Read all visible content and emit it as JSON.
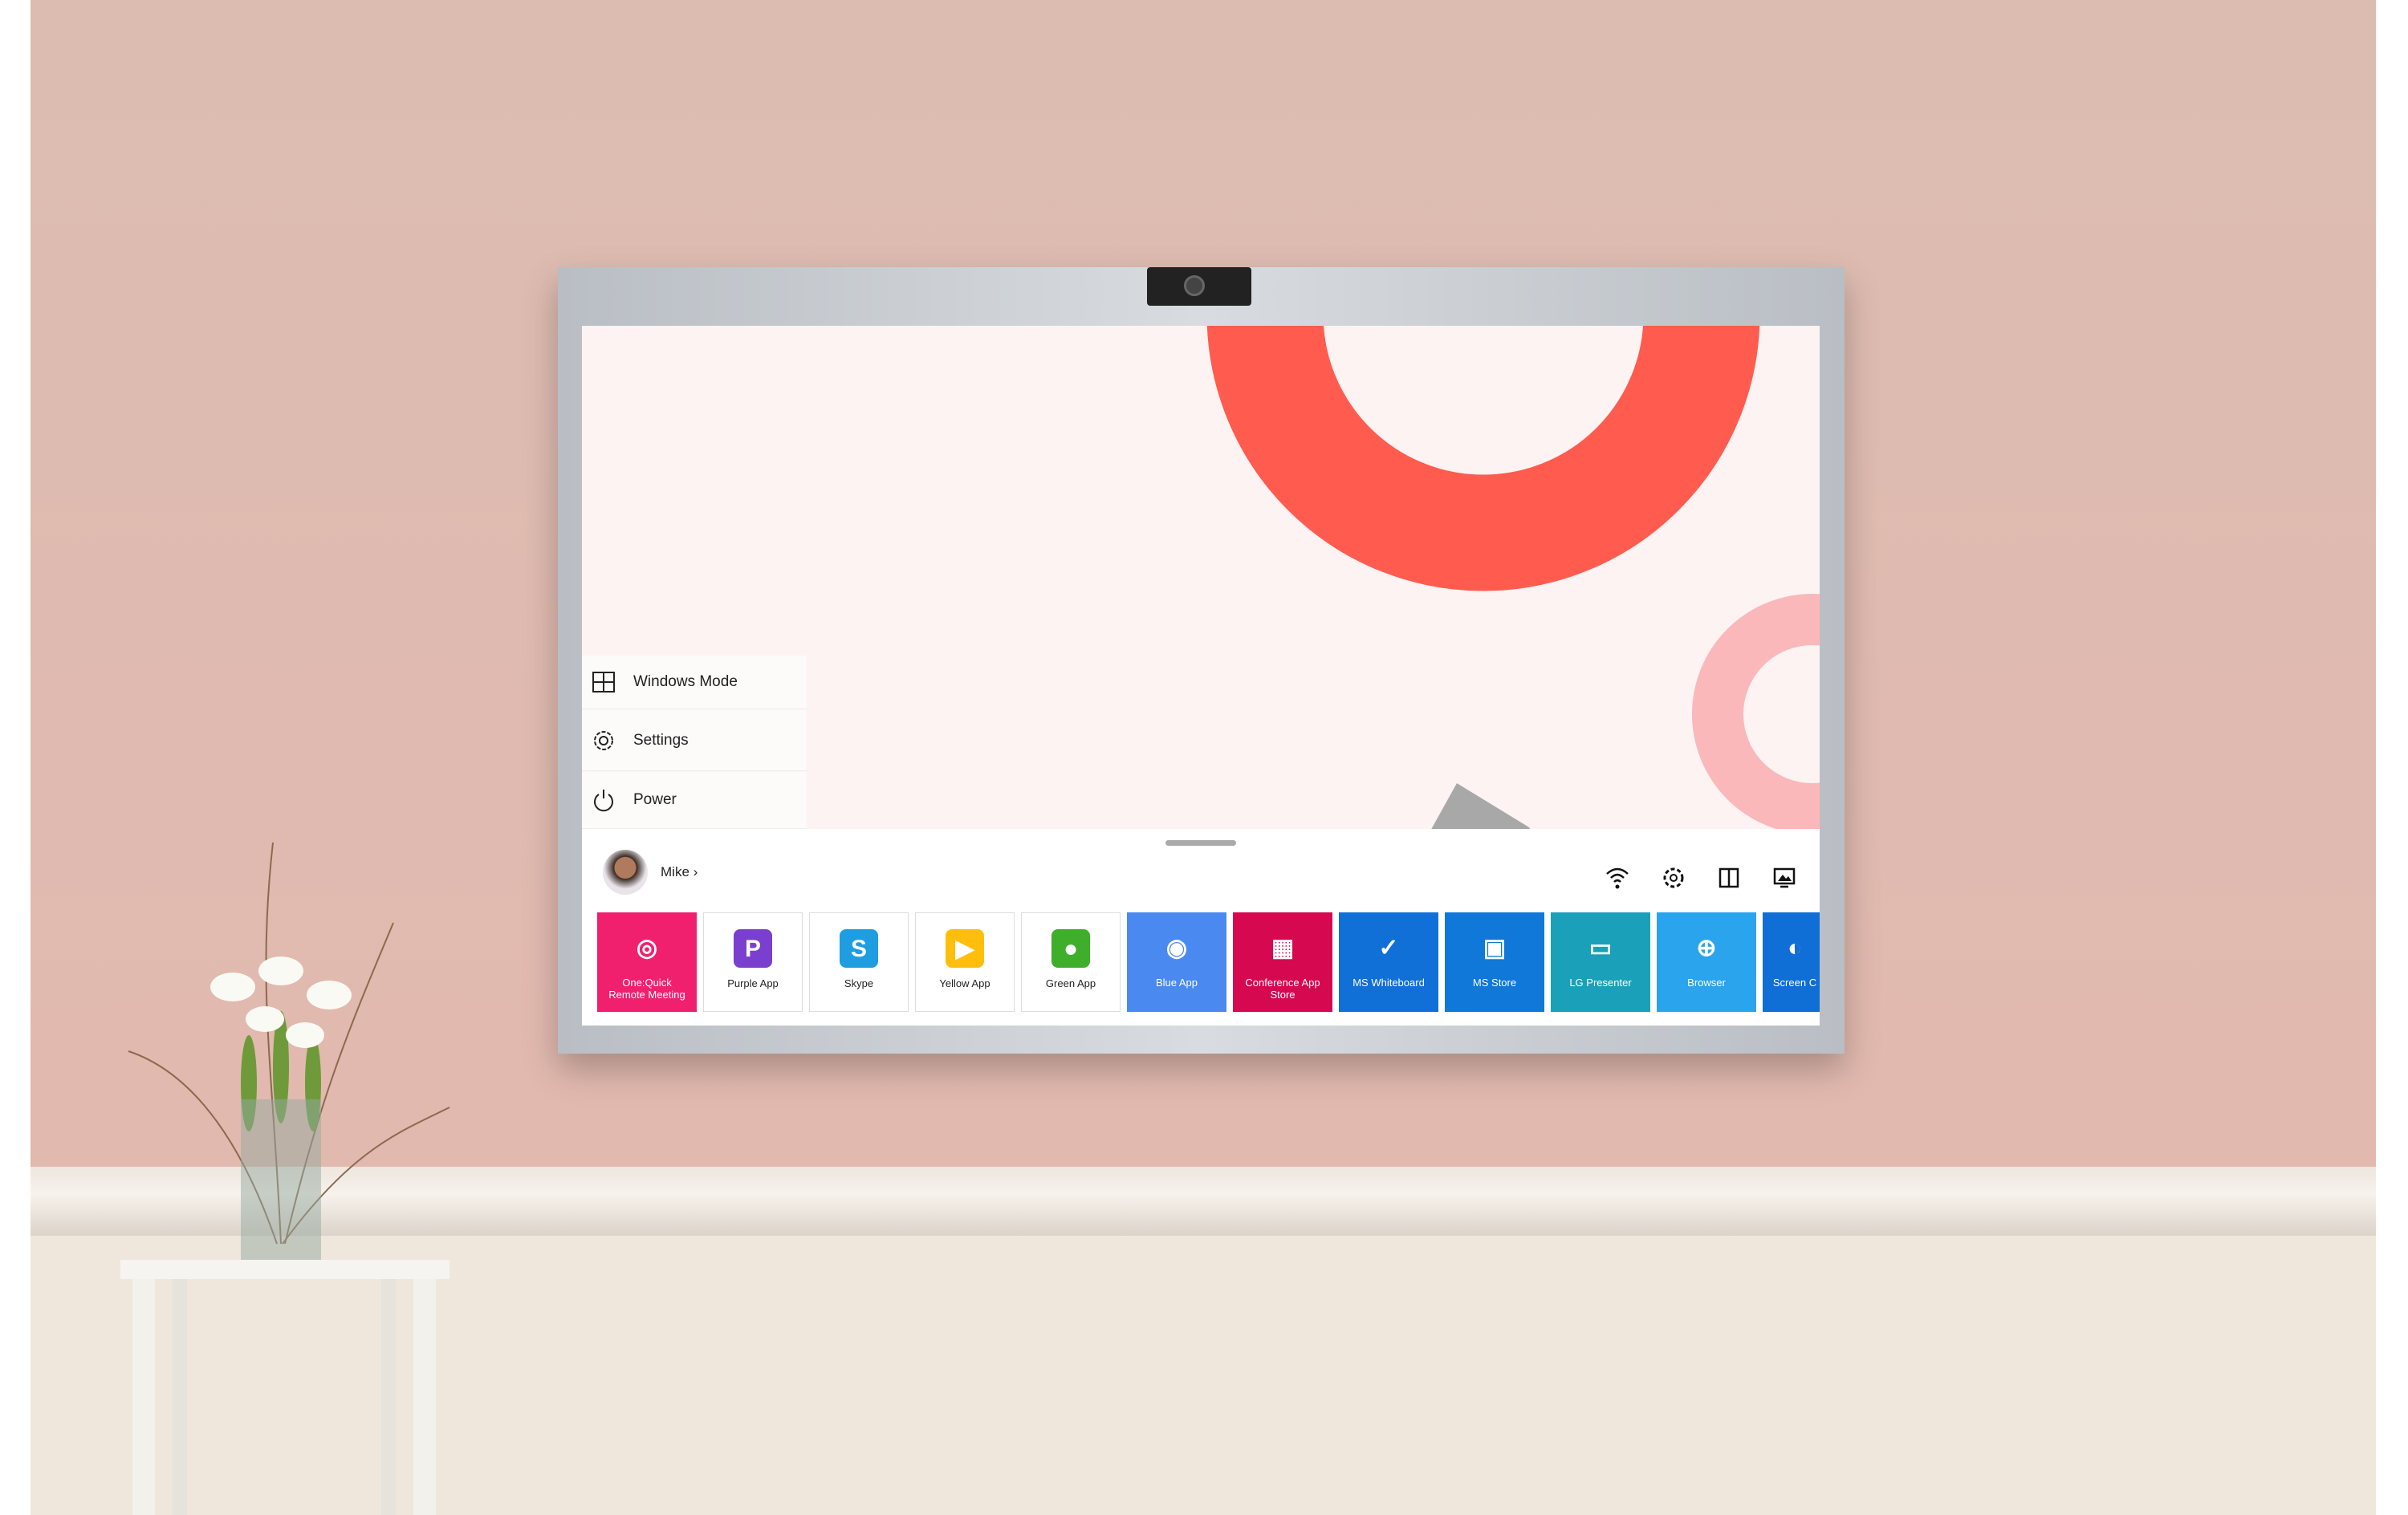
{
  "menu": [
    {
      "label": "Windows Mode",
      "icon": "windows-grid-icon"
    },
    {
      "label": "Settings",
      "icon": "gear-icon"
    },
    {
      "label": "Power",
      "icon": "power-icon"
    }
  ],
  "user": {
    "name": "Mike",
    "chevron": "›"
  },
  "status_icons": [
    "wifi-icon",
    "settings-cog-icon",
    "split-screen-icon",
    "screen-share-icon"
  ],
  "apps": [
    {
      "label": "One:Quick Remote Meeting",
      "bg": "#f0206f",
      "glyph": "◎"
    },
    {
      "label": "Purple App",
      "bg": "#ffffff",
      "icon_bg": "#7b3fd0",
      "glyph": "P"
    },
    {
      "label": "Skype",
      "bg": "#ffffff",
      "icon_bg": "#1e9de0",
      "glyph": "S"
    },
    {
      "label": "Yellow App",
      "bg": "#ffffff",
      "icon_bg": "#ffbe0b",
      "glyph": "▶"
    },
    {
      "label": "Green App",
      "bg": "#ffffff",
      "icon_bg": "#3fae2a",
      "glyph": "●"
    },
    {
      "label": "Blue App",
      "bg": "#4a8af0",
      "glyph": "◉"
    },
    {
      "label": "Conference App Store",
      "bg": "#d6084f",
      "glyph": "▦"
    },
    {
      "label": "MS Whiteboard",
      "bg": "#1170d8",
      "glyph": "✓"
    },
    {
      "label": "MS Store",
      "bg": "#0f78d9",
      "glyph": "▣"
    },
    {
      "label": "LG Presenter",
      "bg": "#1aa0b8",
      "glyph": "▭"
    },
    {
      "label": "Browser",
      "bg": "#2aa4ec",
      "glyph": "⊕"
    },
    {
      "label": "Screen C",
      "bg": "#0f6fd6",
      "glyph": "◐"
    }
  ],
  "colors": {
    "wall": "#dcbcb1",
    "accent_ring": "#ff5a4f",
    "pink_ring": "#fbb8bb"
  }
}
